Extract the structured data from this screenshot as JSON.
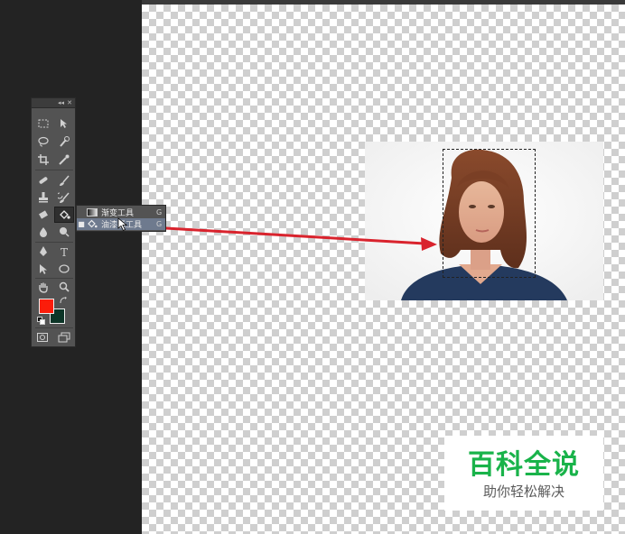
{
  "toolbox": {
    "collapse_icon": "double-chevron-left-icon",
    "close_icon": "close-icon",
    "foreground_color": "#fb1c0a",
    "background_color": "#0c3527"
  },
  "flyout": {
    "items": [
      {
        "label": "渐变工具",
        "shortcut": "G",
        "icon": "gradient-icon",
        "selected": false
      },
      {
        "label": "油漆桶工具",
        "shortcut": "G",
        "icon": "paint-bucket-icon",
        "selected": true
      }
    ],
    "selected_marker": "■"
  },
  "watermark": {
    "title": "百科全说",
    "subtitle": "助你轻松解决",
    "brand_color": "#19b34a"
  },
  "annotation_arrow_color": "#d9232d"
}
